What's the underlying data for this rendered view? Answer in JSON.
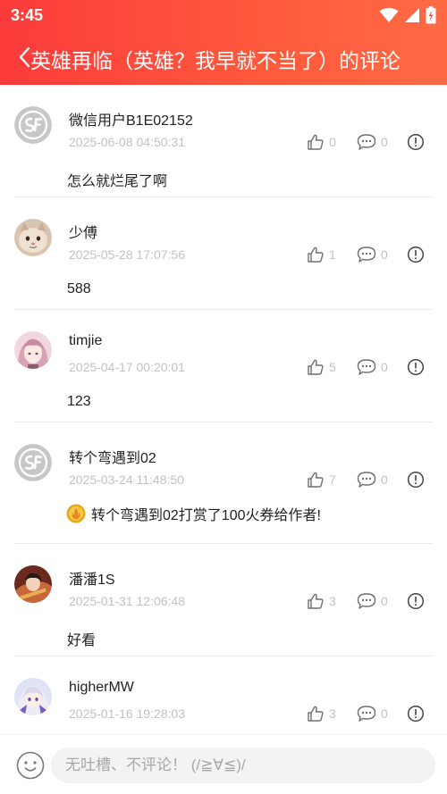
{
  "status_bar": {
    "time": "3:45"
  },
  "header": {
    "title": "英雄再临（英雄？我早就不当了）的评论"
  },
  "comments": [
    {
      "username": "微信用户B1E02152",
      "timestamp": "2025-06-08 04:50:31",
      "likes": "0",
      "replies": "0",
      "content": "怎么就烂尾了啊",
      "avatar": "sf-logo-avatar"
    },
    {
      "username": "少傅",
      "timestamp": "2025-05-28 17:07:56",
      "likes": "1",
      "replies": "0",
      "content": "588",
      "avatar": "cat-photo-avatar"
    },
    {
      "username": "timjie",
      "timestamp": "2025-04-17 00:20:01",
      "likes": "5",
      "replies": "0",
      "content": "123",
      "avatar": "anime-girl-avatar"
    },
    {
      "username": "转个弯遇到02",
      "timestamp": "2025-03-24 11:48:50",
      "likes": "7",
      "replies": "0",
      "content": "转个弯遇到02打赏了100火券给作者!",
      "avatar": "sf-logo-avatar",
      "reward_icon": "gold-coin-icon"
    },
    {
      "username": "潘潘1S",
      "timestamp": "2025-01-31 12:06:48",
      "likes": "3",
      "replies": "0",
      "content": "好看",
      "avatar": "anime-character-avatar"
    },
    {
      "username": "higherMW",
      "timestamp": "2025-01-16 19:28:03",
      "likes": "3",
      "replies": "0",
      "content": "",
      "avatar": "anime-girl-purple-avatar"
    }
  ],
  "composer": {
    "placeholder": "无吐槽、不评论！ (/≧∀≦)/"
  },
  "colors": {
    "header_start": "#fb3b3b",
    "header_end": "#ff6a45",
    "muted_text": "#c2c2c2"
  }
}
